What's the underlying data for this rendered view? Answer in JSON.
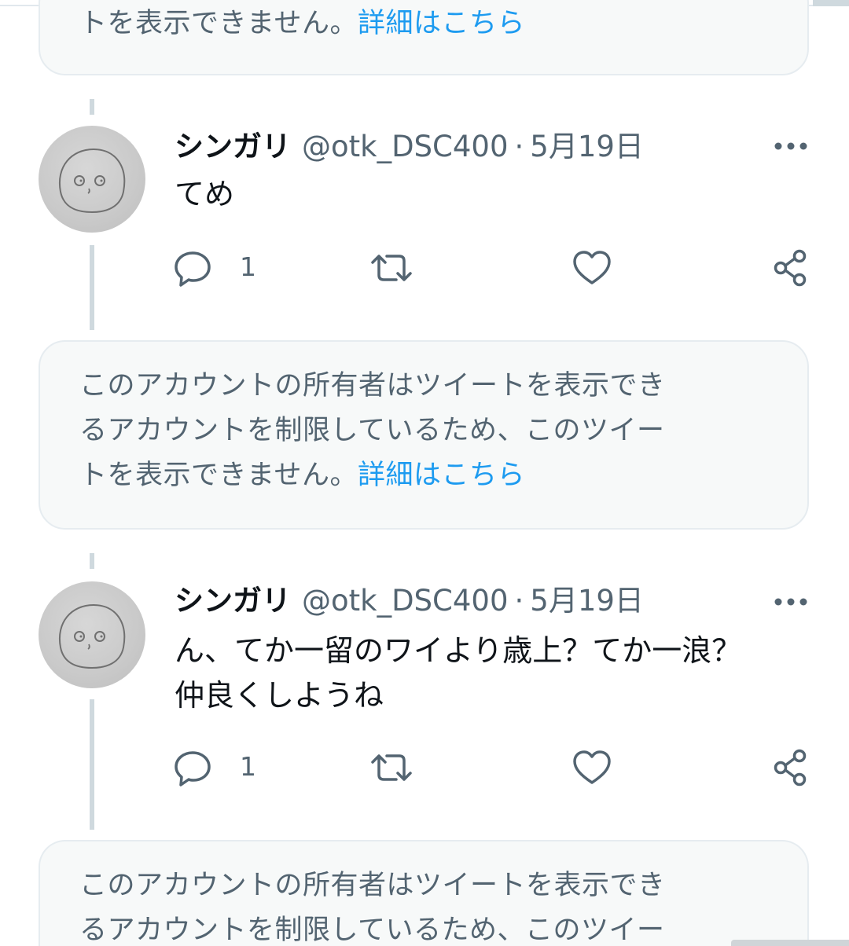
{
  "restricted_notice": {
    "line1": "このアカウントの所有者はツイートを表示でき",
    "line2": "るアカウントを制限しているため、このツイー",
    "line3": "トを表示できません。",
    "link": "詳細はこちら"
  },
  "tweets": [
    {
      "name": "シンガリ",
      "handle": "@otk_DSC400",
      "separator": "·",
      "date": "5月19日",
      "text_lines": [
        "てめ"
      ],
      "reply_count": "1"
    },
    {
      "name": "シンガリ",
      "handle": "@otk_DSC400",
      "separator": "·",
      "date": "5月19日",
      "text_lines": [
        "ん、てか一留のワイより歳上？てか一浪？",
        "仲良くしようね"
      ],
      "reply_count": "1"
    }
  ],
  "icons": {
    "more": "more-icon",
    "reply": "reply-icon",
    "retweet": "retweet-icon",
    "like": "heart-icon",
    "share": "share-icon"
  },
  "colors": {
    "link": "#1d9bf0",
    "muted": "#536471",
    "notice_bg": "#f7f9f9",
    "thread_line": "#cfd9de"
  }
}
